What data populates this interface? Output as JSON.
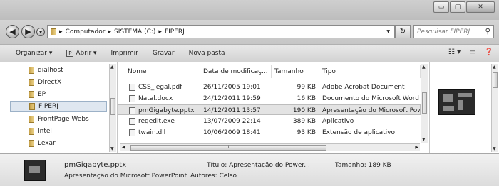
{
  "window": {
    "minimize": "▭",
    "maximize": "▢",
    "close": "✕"
  },
  "address": {
    "crumbs": [
      "Computador",
      "SISTEMA (C:)",
      "FIPERJ"
    ],
    "search_placeholder": "Pesquisar FIPERJ"
  },
  "toolbar": {
    "items": [
      "Organizar ▾",
      "Abrir ▾",
      "Imprimir",
      "Gravar",
      "Nova pasta"
    ]
  },
  "nav": {
    "items": [
      "dialhost",
      "DirectX",
      "EP",
      "FIPERJ",
      "FrontPage Webs",
      "Intel",
      "Lexar"
    ],
    "selected_index": 3
  },
  "files": {
    "columns": [
      "Nome",
      "Data de modificaç...",
      "Tamanho",
      "Tipo"
    ],
    "rows": [
      {
        "name": "CSS_legal.pdf",
        "date": "26/11/2005 19:01",
        "size": "99 KB",
        "type": "Adobe Acrobat Document"
      },
      {
        "name": "Natal.docx",
        "date": "24/12/2011 19:59",
        "size": "16 KB",
        "type": "Documento do Microsoft Word"
      },
      {
        "name": "pmGigabyte.pptx",
        "date": "14/12/2011 13:57",
        "size": "190 KB",
        "type": "Apresentação do Microsoft PowerPoint"
      },
      {
        "name": "regedit.exe",
        "date": "13/07/2009 22:14",
        "size": "389 KB",
        "type": "Aplicativo"
      },
      {
        "name": "twain.dll",
        "date": "10/06/2009 18:41",
        "size": "93 KB",
        "type": "Extensão de aplicativo"
      }
    ],
    "selected_index": 2
  },
  "details": {
    "filename": "pmGigabyte.pptx",
    "filetype": "Apresentação do Microsoft PowerPoint",
    "title": "Título: Apresentação do Power...",
    "authors": "Autores: Celso",
    "size": "Tamanho: 189 KB"
  }
}
